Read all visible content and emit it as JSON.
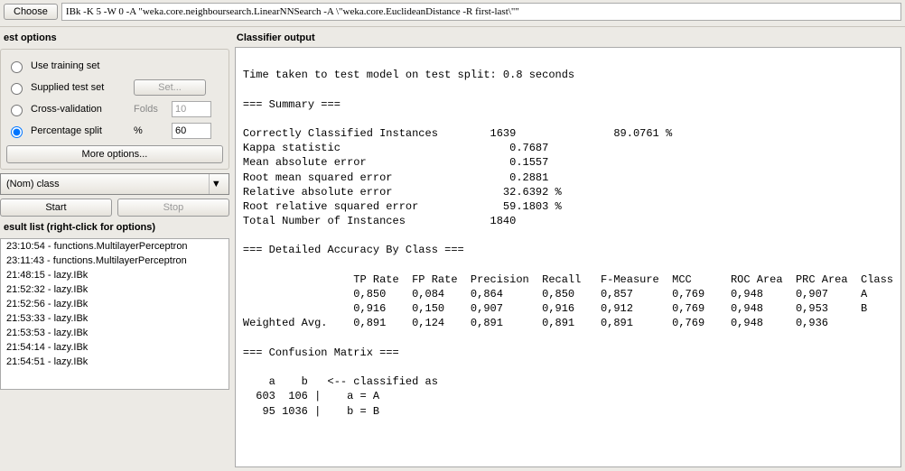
{
  "top": {
    "choose_label": "Choose",
    "command": "IBk -K 5 -W 0 -A \"weka.core.neighboursearch.LinearNNSearch -A \\\"weka.core.EuclideanDistance -R first-last\\\"\""
  },
  "test_options": {
    "title": "est options",
    "use_training": "Use training set",
    "supplied": "Supplied test set",
    "set_btn": "Set...",
    "cv": "Cross-validation",
    "folds_label": "Folds",
    "folds_value": "10",
    "pct": "Percentage split",
    "pct_sym": "%",
    "pct_value": "60",
    "more": "More options..."
  },
  "class_combo": {
    "value": "(Nom) class"
  },
  "run": {
    "start": "Start",
    "stop": "Stop"
  },
  "result_list": {
    "title": "esult list (right-click for options)",
    "items": [
      "23:10:54 - functions.MultilayerPerceptron",
      "23:11:43 - functions.MultilayerPerceptron",
      "21:48:15 - lazy.IBk",
      "21:52:32 - lazy.IBk",
      "21:52:56 - lazy.IBk",
      "21:53:33 - lazy.IBk",
      "21:53:53 - lazy.IBk",
      "21:54:14 - lazy.IBk",
      "21:54:51 - lazy.IBk"
    ]
  },
  "output": {
    "title": "Classifier output",
    "text": "\nTime taken to test model on test split: 0.8 seconds\n\n=== Summary ===\n\nCorrectly Classified Instances        1639               89.0761 %\nKappa statistic                          0.7687\nMean absolute error                      0.1557\nRoot mean squared error                  0.2881\nRelative absolute error                 32.6392 %\nRoot relative squared error             59.1803 %\nTotal Number of Instances             1840     \n\n=== Detailed Accuracy By Class ===\n\n                 TP Rate  FP Rate  Precision  Recall   F-Measure  MCC      ROC Area  PRC Area  Class\n                 0,850    0,084    0,864      0,850    0,857      0,769    0,948     0,907     A\n                 0,916    0,150    0,907      0,916    0,912      0,769    0,948     0,953     B\nWeighted Avg.    0,891    0,124    0,891      0,891    0,891      0,769    0,948     0,936     \n\n=== Confusion Matrix ===\n\n    a    b   <-- classified as\n  603  106 |    a = A\n   95 1036 |    b = B"
  }
}
